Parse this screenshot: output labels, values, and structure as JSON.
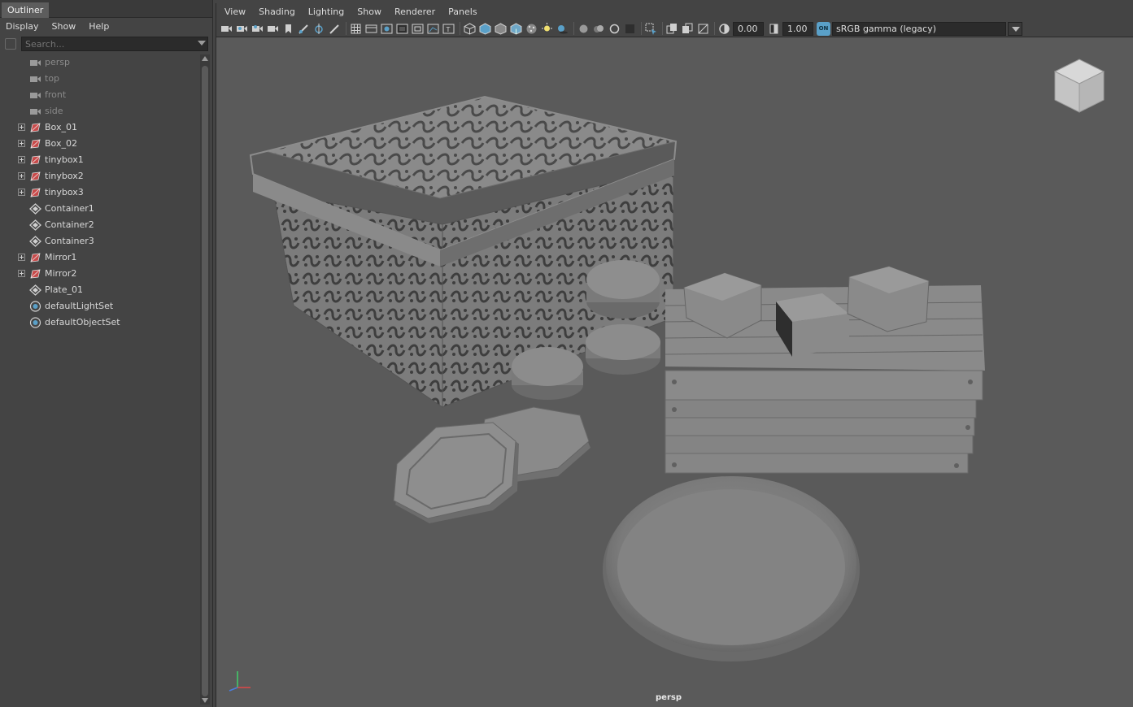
{
  "outliner": {
    "tab_title": "Outliner",
    "menus": [
      "Display",
      "Show",
      "Help"
    ],
    "search_placeholder": "Search...",
    "items": [
      {
        "label": "persp",
        "type": "camera",
        "dim": true,
        "expandable": false
      },
      {
        "label": "top",
        "type": "camera",
        "dim": true,
        "expandable": false
      },
      {
        "label": "front",
        "type": "camera",
        "dim": true,
        "expandable": false
      },
      {
        "label": "side",
        "type": "camera",
        "dim": true,
        "expandable": false
      },
      {
        "label": "Box_01",
        "type": "mesh",
        "dim": false,
        "expandable": true
      },
      {
        "label": "Box_02",
        "type": "mesh",
        "dim": false,
        "expandable": true
      },
      {
        "label": "tinybox1",
        "type": "mesh",
        "dim": false,
        "expandable": true
      },
      {
        "label": "tinybox2",
        "type": "mesh",
        "dim": false,
        "expandable": true
      },
      {
        "label": "tinybox3",
        "type": "mesh",
        "dim": false,
        "expandable": true
      },
      {
        "label": "Container1",
        "type": "transform",
        "dim": false,
        "expandable": false
      },
      {
        "label": "Container2",
        "type": "transform",
        "dim": false,
        "expandable": false
      },
      {
        "label": "Container3",
        "type": "transform",
        "dim": false,
        "expandable": false
      },
      {
        "label": "Mirror1",
        "type": "mesh",
        "dim": false,
        "expandable": true
      },
      {
        "label": "Mirror2",
        "type": "mesh",
        "dim": false,
        "expandable": true
      },
      {
        "label": "Plate_01",
        "type": "transform",
        "dim": false,
        "expandable": false
      },
      {
        "label": "defaultLightSet",
        "type": "set",
        "dim": false,
        "expandable": false
      },
      {
        "label": "defaultObjectSet",
        "type": "set",
        "dim": false,
        "expandable": false
      }
    ]
  },
  "viewport": {
    "menus": [
      "View",
      "Shading",
      "Lighting",
      "Show",
      "Renderer",
      "Panels"
    ],
    "exposure": "0.00",
    "gamma": "1.00",
    "color_management_toggle": "ON",
    "color_space": "sRGB gamma (legacy)",
    "camera_label": "persp"
  },
  "colors": {
    "panel_bg": "#444444",
    "viewport_bg": "#5a5a5a",
    "accent": "#5aa0c8",
    "mesh_icon": "#c84a4a"
  }
}
